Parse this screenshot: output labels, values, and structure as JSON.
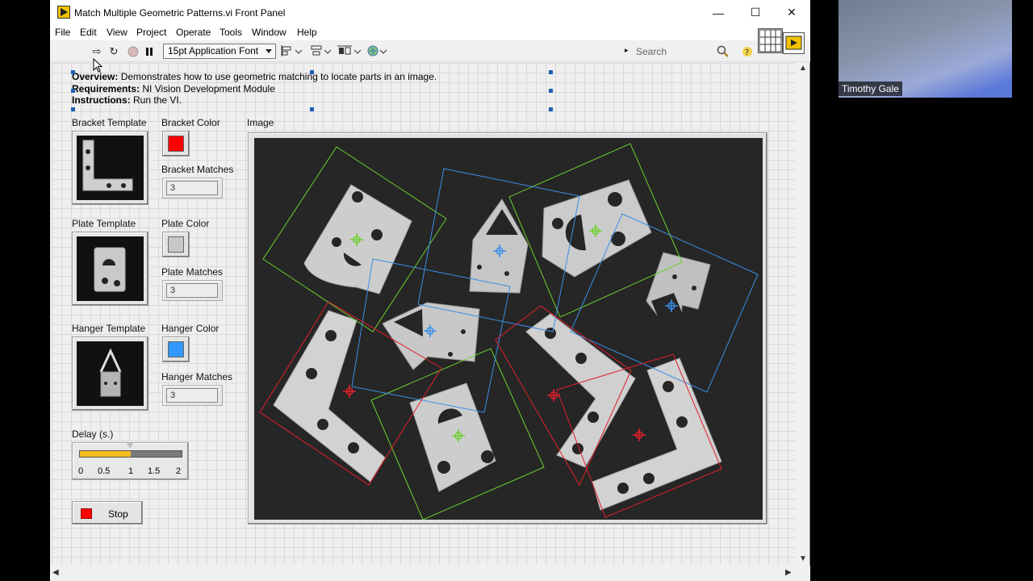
{
  "window": {
    "title": "Match Multiple Geometric Patterns.vi Front Panel",
    "minimize": "—",
    "maximize": "☐",
    "close": "✕"
  },
  "menu": [
    "File",
    "Edit",
    "View",
    "Project",
    "Operate",
    "Tools",
    "Window",
    "Help"
  ],
  "toolbar": {
    "font": "15pt Application Font",
    "search_placeholder": "Search"
  },
  "description": {
    "overview_label": "Overview:",
    "overview_text": " Demonstrates how to use geometric matching to locate parts in an image.",
    "requirements_label": "Requirements:",
    "requirements_text": " NI Vision Development Module",
    "instructions_label": "Instructions:",
    "instructions_text": " Run the VI."
  },
  "controls": {
    "bracket_template_label": "Bracket Template",
    "bracket_color_label": "Bracket Color",
    "bracket_color": "#ff0000",
    "bracket_matches_label": "Bracket Matches",
    "bracket_matches": "3",
    "plate_template_label": "Plate Template",
    "plate_color_label": "Plate Color",
    "plate_color": "#c8c8c8",
    "plate_matches_label": "Plate Matches",
    "plate_matches": "3",
    "hanger_template_label": "Hanger Template",
    "hanger_color_label": "Hanger Color",
    "hanger_color": "#3399ff",
    "hanger_matches_label": "Hanger Matches",
    "hanger_matches": "3",
    "delay_label": "Delay (s.)",
    "delay_value": 1,
    "delay_ticks": [
      "0",
      "0.5",
      "1",
      "1.5",
      "2"
    ],
    "stop_label": "Stop",
    "image_label": "Image"
  },
  "overlay_colors": {
    "bracket": "#e0202a",
    "plate": "#6cd030",
    "hanger": "#3a8fe8"
  },
  "participant": {
    "name": "Timothy Gale"
  }
}
